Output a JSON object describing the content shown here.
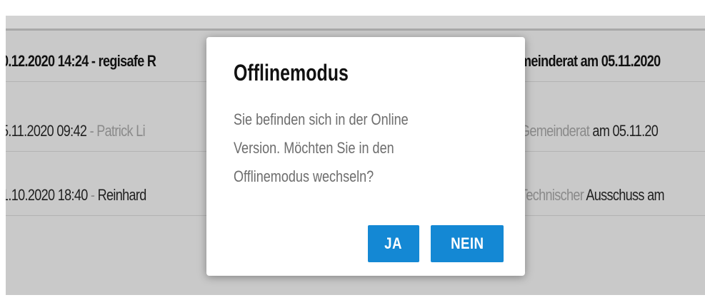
{
  "list": {
    "rows": [
      {
        "left_bold": "0.12.2020 14:24 - regisafe R",
        "right_bold": "meinderat am 05.11.2020"
      },
      {
        "left_dark": "5.11.2020 09:42",
        "left_muted": " - Patrick Li",
        "right_muted": "Gemeinderat",
        "right_dark": " am 05.11.20"
      },
      {
        "left_dark": "1.10.2020 18:40",
        "left_muted": " - ",
        "left_dark2": "Reinhard",
        "right_muted": "Technischer",
        "right_dark": " Ausschuss am"
      }
    ]
  },
  "modal": {
    "title": "Offlinemodus",
    "body_lines": [
      "Sie befinden sich in der Online",
      "Version. Möchten Sie in den",
      "Offlinemodus wechseln?"
    ],
    "confirm_label": "JA",
    "cancel_label": "NEIN"
  },
  "colors": {
    "accent": "#1488d4",
    "overlay": "#c9c9c9",
    "muted_text": "#8a8a8a"
  }
}
